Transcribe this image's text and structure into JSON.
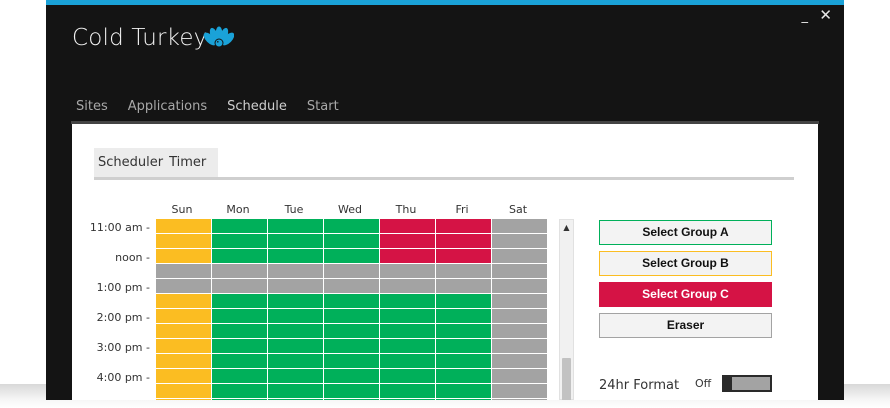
{
  "app": {
    "title": "Cold Turkey",
    "accent": "#1aa2d8",
    "logo_icon": "turkey-icon"
  },
  "window_controls": {
    "minimize": "_",
    "close": "✕"
  },
  "main_tabs": [
    "Sites",
    "Applications",
    "Schedule",
    "Start"
  ],
  "active_main_tab": "Schedule",
  "sub_tabs": [
    "Scheduler",
    "Timer"
  ],
  "active_sub_tab": "Scheduler",
  "schedule": {
    "days": [
      "Sun",
      "Mon",
      "Tue",
      "Wed",
      "Thu",
      "Fri",
      "Sat"
    ],
    "time_labels": [
      "11:00 am -",
      "noon -",
      "1:00 pm -",
      "2:00 pm -",
      "3:00 pm -",
      "4:00 pm -"
    ],
    "group_colors": {
      "A": "#00b05a",
      "B": "#fbbd22",
      "C": "#d51345",
      "none": "#a3a3a3"
    },
    "rows": [
      [
        "B",
        "A",
        "A",
        "A",
        "C",
        "C",
        "none"
      ],
      [
        "B",
        "A",
        "A",
        "A",
        "C",
        "C",
        "none"
      ],
      [
        "B",
        "A",
        "A",
        "A",
        "C",
        "C",
        "none"
      ],
      [
        "none",
        "none",
        "none",
        "none",
        "none",
        "none",
        "none"
      ],
      [
        "none",
        "none",
        "none",
        "none",
        "none",
        "none",
        "none"
      ],
      [
        "B",
        "A",
        "A",
        "A",
        "A",
        "A",
        "none"
      ],
      [
        "B",
        "A",
        "A",
        "A",
        "A",
        "A",
        "none"
      ],
      [
        "B",
        "A",
        "A",
        "A",
        "A",
        "A",
        "none"
      ],
      [
        "B",
        "A",
        "A",
        "A",
        "A",
        "A",
        "none"
      ],
      [
        "B",
        "A",
        "A",
        "A",
        "A",
        "A",
        "none"
      ],
      [
        "B",
        "A",
        "A",
        "A",
        "A",
        "A",
        "none"
      ],
      [
        "B",
        "A",
        "A",
        "A",
        "A",
        "A",
        "none"
      ],
      [
        "B",
        "A",
        "A",
        "A",
        "A",
        "A",
        "none"
      ]
    ]
  },
  "buttons": {
    "group_a": "Select Group A",
    "group_b": "Select Group B",
    "group_c": "Select Group C",
    "eraser": "Eraser"
  },
  "format": {
    "label": "24hr Format",
    "state": "Off"
  },
  "scrollbar": {
    "up_arrow": "▲"
  }
}
